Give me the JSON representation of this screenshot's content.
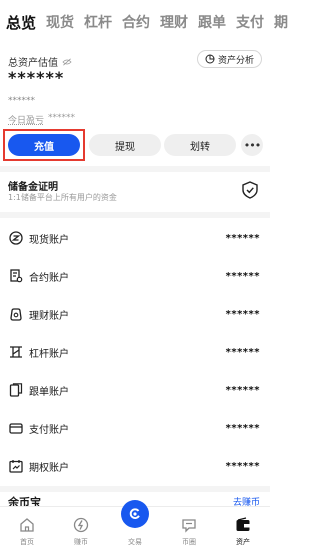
{
  "tabs": [
    "总览",
    "现货",
    "杠杆",
    "合约",
    "理财",
    "跟单",
    "支付",
    "期"
  ],
  "overview": {
    "estimate_label": "总资产估值",
    "analysis_label": "资产分析",
    "balance": "******",
    "sub_balance": "******",
    "pnl_label": "今日盈亏",
    "pnl_value": "******"
  },
  "actions": {
    "deposit": "充值",
    "withdraw": "提现",
    "transfer": "划转",
    "more": "•••"
  },
  "reserve": {
    "title": "储备金证明",
    "subtitle": "1:1储备平台上所有用户的资金"
  },
  "accounts": [
    {
      "icon": "spot-account-icon",
      "label": "现货账户",
      "value": "******"
    },
    {
      "icon": "futures-account-icon",
      "label": "合约账户",
      "value": "******"
    },
    {
      "icon": "finance-account-icon",
      "label": "理财账户",
      "value": "******"
    },
    {
      "icon": "margin-account-icon",
      "label": "杠杆账户",
      "value": "******"
    },
    {
      "icon": "copy-trade-account-icon",
      "label": "跟单账户",
      "value": "******"
    },
    {
      "icon": "payment-account-icon",
      "label": "支付账户",
      "value": "******"
    },
    {
      "icon": "options-account-icon",
      "label": "期权账户",
      "value": "******"
    }
  ],
  "yubao": {
    "title": "余币宝",
    "link": "去赚币"
  },
  "bottom_nav": [
    {
      "label": "首页",
      "icon": "home-icon"
    },
    {
      "label": "赚币",
      "icon": "earn-icon"
    },
    {
      "label": "交易",
      "icon": "trade-icon"
    },
    {
      "label": "币圈",
      "icon": "community-icon"
    },
    {
      "label": "资产",
      "icon": "wallet-icon"
    }
  ],
  "colors": {
    "primary": "#1858ef",
    "highlight": "#e53a2f"
  }
}
